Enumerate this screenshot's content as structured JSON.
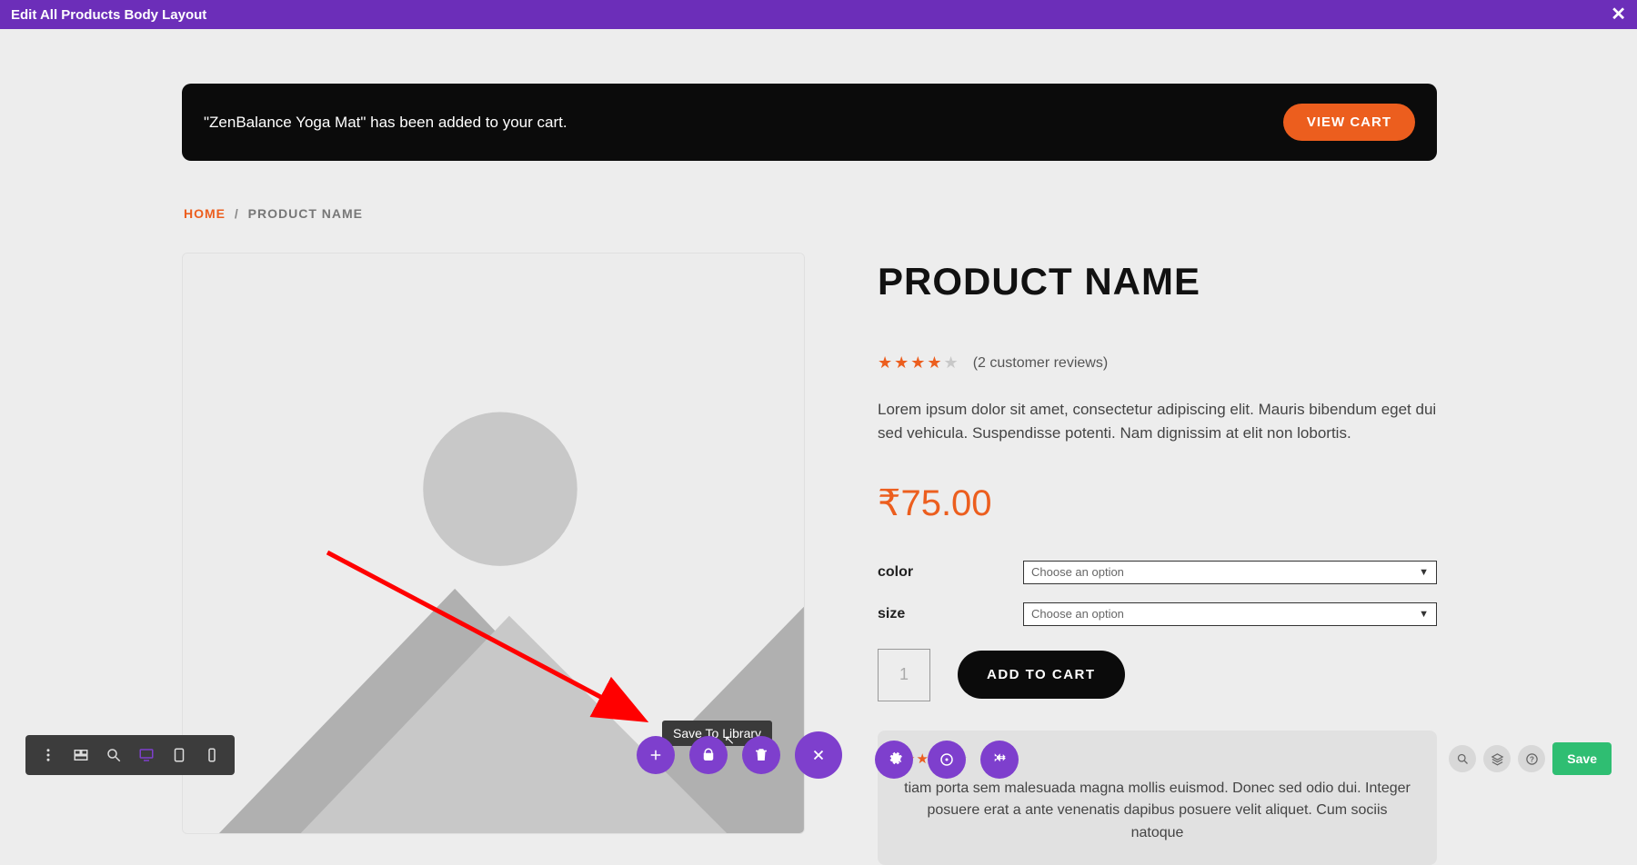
{
  "topbar": {
    "title": "Edit All Products Body Layout"
  },
  "notice": {
    "message": "\"ZenBalance Yoga Mat\" has been added to your cart.",
    "button": "VIEW CART"
  },
  "breadcrumb": {
    "home": "HOME",
    "sep": "/",
    "current": "PRODUCT NAME"
  },
  "product": {
    "title": "PRODUCT NAME",
    "reviews_text": "(2 customer reviews)",
    "description": "Lorem ipsum dolor sit amet, consectetur adipiscing elit. Mauris bibendum eget dui sed vehicula. Suspendisse potenti. Nam dignissim at elit non lobortis.",
    "price": "₹75.00",
    "variations": {
      "color": {
        "label": "color",
        "selected": "Choose an option"
      },
      "size": {
        "label": "size",
        "selected": "Choose an option"
      }
    },
    "qty": "1",
    "add_to_cart": "ADD TO CART",
    "review": {
      "text": "tiam porta sem malesuada magna mollis euismod. Donec sed odio dui. Integer posuere erat a ante venenatis dapibus posuere velit aliquet. Cum sociis natoque"
    }
  },
  "tooltip": {
    "text": "Save To Library"
  },
  "save_button": "Save"
}
